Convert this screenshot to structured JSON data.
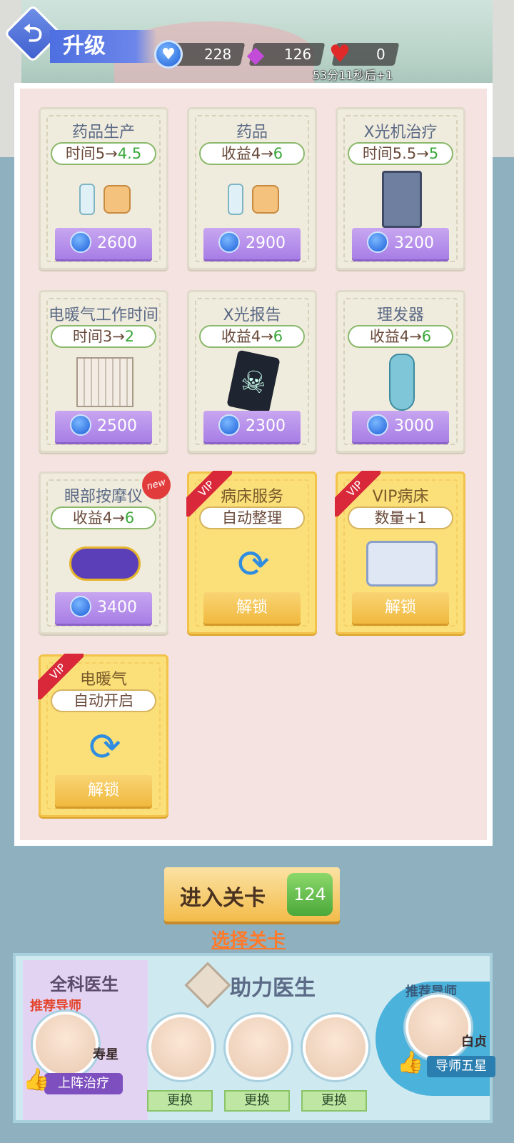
{
  "header": {
    "title": "升级",
    "coins": "228",
    "gems": "126",
    "hearts": "0",
    "heart_timer": "53分11秒后+1"
  },
  "upgrades": [
    {
      "name": "药品生产",
      "effect_prefix": "时间5→",
      "effect_value": "4.5",
      "price": "2600"
    },
    {
      "name": "药品",
      "effect_prefix": "收益4→",
      "effect_value": "6",
      "price": "2900"
    },
    {
      "name": "X光机治疗",
      "effect_prefix": "时间5.5→",
      "effect_value": "5",
      "price": "3200"
    },
    {
      "name": "电暖气工作时间",
      "effect_prefix": "时间3→",
      "effect_value": "2",
      "price": "2500"
    },
    {
      "name": "X光报告",
      "effect_prefix": "收益4→",
      "effect_value": "6",
      "price": "2300"
    },
    {
      "name": "理发器",
      "effect_prefix": "收益4→",
      "effect_value": "6",
      "price": "3000"
    },
    {
      "name": "眼部按摩仪",
      "effect_prefix": "收益4→",
      "effect_value": "6",
      "price": "3400",
      "badge": "new"
    },
    {
      "name": "病床服务",
      "effect": "自动整理",
      "button": "解锁",
      "ribbon": "VIP"
    },
    {
      "name": "VIP病床",
      "effect": "数量+1",
      "button": "解锁",
      "ribbon": "VIP"
    },
    {
      "name": "电暖气",
      "effect": "自动开启",
      "button": "解锁",
      "ribbon": "VIP"
    }
  ],
  "level": {
    "enter_label": "进入关卡",
    "level_number": "124",
    "select_label": "选择关卡"
  },
  "doctors": {
    "gp_title": "全科医生",
    "recommend_left": "推荐导师",
    "gp_name": "寿星",
    "onboard_label": "上阵治疗",
    "helper_title": "助力医生",
    "swap_label": "更换",
    "recommend_right": "推荐导师",
    "mentor_name": "白贞",
    "mentor_rank": "导师五星"
  },
  "colors": {
    "accent_purple": "#a77ee6",
    "vip_gold": "#f0b93f",
    "effect_green": "#3aa83a",
    "link_orange": "#ff7a2a"
  }
}
